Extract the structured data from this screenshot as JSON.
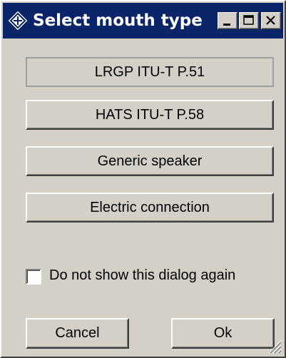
{
  "window": {
    "title": "Select mouth type"
  },
  "buttons": {
    "lrgp": "LRGP ITU-T P.51",
    "hats": "HATS ITU-T P.58",
    "generic": "Generic speaker",
    "electric": "Electric connection"
  },
  "checkbox": {
    "label": "Do not show this dialog again",
    "checked": false
  },
  "footer": {
    "cancel": "Cancel",
    "ok": "Ok"
  },
  "colors": {
    "titlebar": "#0a246a",
    "face": "#d4d0c8"
  },
  "icons": {
    "app": "diamond-logo-icon",
    "minimize": "minimize-icon",
    "maximize": "maximize-icon",
    "close": "close-icon"
  }
}
